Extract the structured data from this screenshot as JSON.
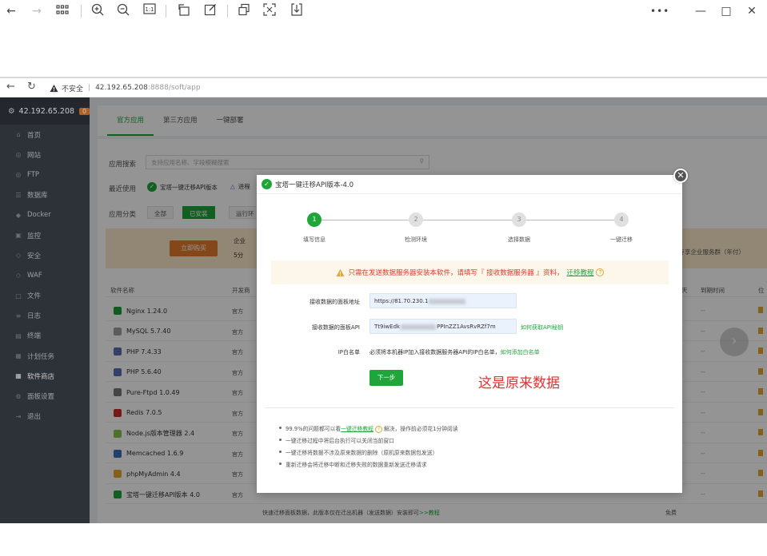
{
  "viewer": {
    "more_label": "•••",
    "minimize_label": "—",
    "maximize_label": "□",
    "close_label": "✕"
  },
  "browser": {
    "security_label": "不安全",
    "host": "42.192.65.208",
    "port_path": ":8888/soft/app"
  },
  "sidebar": {
    "server": "42.192.65.208",
    "badge": "0",
    "items": [
      {
        "label": "首页",
        "icon": "home-icon"
      },
      {
        "label": "网站",
        "icon": "globe-icon"
      },
      {
        "label": "FTP",
        "icon": "ftp-icon"
      },
      {
        "label": "数据库",
        "icon": "database-icon"
      },
      {
        "label": "Docker",
        "icon": "docker-icon"
      },
      {
        "label": "监控",
        "icon": "monitor-icon"
      },
      {
        "label": "安全",
        "icon": "shield-icon"
      },
      {
        "label": "WAF",
        "icon": "waf-icon"
      },
      {
        "label": "文件",
        "icon": "folder-icon"
      },
      {
        "label": "日志",
        "icon": "log-icon"
      },
      {
        "label": "终端",
        "icon": "terminal-icon"
      },
      {
        "label": "计划任务",
        "icon": "calendar-icon"
      },
      {
        "label": "软件商店",
        "icon": "store-icon"
      },
      {
        "label": "面板设置",
        "icon": "gear-icon"
      },
      {
        "label": "退出",
        "icon": "logout-icon"
      }
    ]
  },
  "tabs": [
    "官方应用",
    "第三方应用",
    "一键部署"
  ],
  "store": {
    "search_label": "应用搜索",
    "search_placeholder": "支持应用名称、字段模糊搜索",
    "recent_label": "最近使用",
    "recent_item": "宝塔一键迁移API版本",
    "recent_item_2": "进程",
    "category_label": "应用分类",
    "cat_all": "全部",
    "cat_installed": "已安装",
    "cat_runtime": "运行环",
    "buy_label": "立即购买",
    "banner_text": "专享企业服务群（年付）",
    "banner_left_1": "企业",
    "banner_left_2": "5分",
    "col_name": "软件名称",
    "col_dev": "开发商",
    "col_expire": "到期时间",
    "col_pay": "天",
    "col_pos": "位",
    "rows": [
      {
        "name": "Nginx 1.24.0",
        "dev": "官方",
        "expire": "--",
        "color": "#1e9e3c"
      },
      {
        "name": "MySQL 5.7.40",
        "dev": "官方",
        "expire": "--",
        "color": "#9aa0a8"
      },
      {
        "name": "PHP 7.4.33",
        "dev": "官方",
        "expire": "--",
        "color": "#5b6fb3"
      },
      {
        "name": "PHP 5.6.40",
        "dev": "官方",
        "expire": "--",
        "color": "#5b6fb3"
      },
      {
        "name": "Pure-Ftpd 1.0.49",
        "dev": "官方",
        "expire": "--",
        "color": "#777777"
      },
      {
        "name": "Redis 7.0.5",
        "dev": "官方",
        "expire": "--",
        "color": "#c9302c"
      },
      {
        "name": "Node.js版本管理器 2.4",
        "dev": "官方",
        "expire": "--",
        "color": "#8bc34a"
      },
      {
        "name": "Memcached 1.6.9",
        "dev": "官方",
        "expire": "--",
        "color": "#3b6fb6"
      },
      {
        "name": "phpMyAdmin 4.4",
        "dev": "官方",
        "expire": "--",
        "color": "#e5a630"
      },
      {
        "name": "宝塔一键迁移API版本 4.0",
        "dev": "官方",
        "expire": "--",
        "color": "#20a53a"
      }
    ],
    "last_row_desc": "快速迁移面板数据，此版本仅在迁出机器（发送数据）安装即可",
    "last_row_link": ">>教程",
    "last_row_price": "免费"
  },
  "modal": {
    "title": "宝塔一键迁移API版本-4.0",
    "close_label": "✕",
    "steps": [
      {
        "num": "1",
        "label": "填写信息"
      },
      {
        "num": "2",
        "label": "检测环境"
      },
      {
        "num": "3",
        "label": "选择数据"
      },
      {
        "num": "4",
        "label": "一键迁移"
      }
    ],
    "notice_text": "只需在发送数据服务器安装本软件，请填写『 接收数据服务器 』资料，",
    "notice_link": "迁移教程",
    "panel_addr_label": "接收数据的面板地址",
    "panel_addr_value": "https://81.70.230.1",
    "api_label": "接收数据的面板API",
    "api_value_start": "Tt9iwEdk",
    "api_value_end": "PPInZZ1AvsRvRZf7m",
    "api_link": "如何获取API秘钥",
    "ip_label": "IP白名单",
    "ip_text": "必须将本机器IP加入接收数据服务器API的IP白名单，",
    "ip_link": "如何添加白名单",
    "next_label": "下一步",
    "annotation": "这是原来数据",
    "tip1_a": "99.9%的问题都可以看",
    "tip1_link": "一键迁移教程",
    "tip1_b": "解决，操作前必须花1分钟阅读",
    "tip2": "一键迁移过程中将后台执行可以关闭当前窗口",
    "tip3": "一键迁移将数据不涉及原来数据的删除（原机原来数据包发送）",
    "tip4": "重新迁移会将迁移中断和迁移失败的数据重新发送迁移请求"
  }
}
